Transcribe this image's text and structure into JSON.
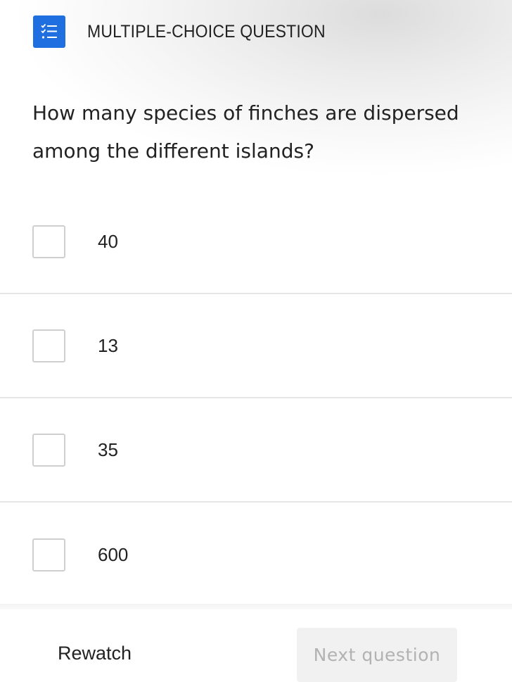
{
  "header": {
    "icon": "checklist-icon",
    "title": "MULTIPLE-CHOICE QUESTION",
    "accent_color": "#1f6fe0"
  },
  "question": {
    "text": "How many species of finches are dispersed among the different islands?"
  },
  "options": [
    {
      "label": "40",
      "checked": false
    },
    {
      "label": "13",
      "checked": false
    },
    {
      "label": "35",
      "checked": false
    },
    {
      "label": "600",
      "checked": false
    }
  ],
  "footer": {
    "rewatch_label": "Rewatch",
    "next_label": "Next question",
    "next_enabled": false
  }
}
